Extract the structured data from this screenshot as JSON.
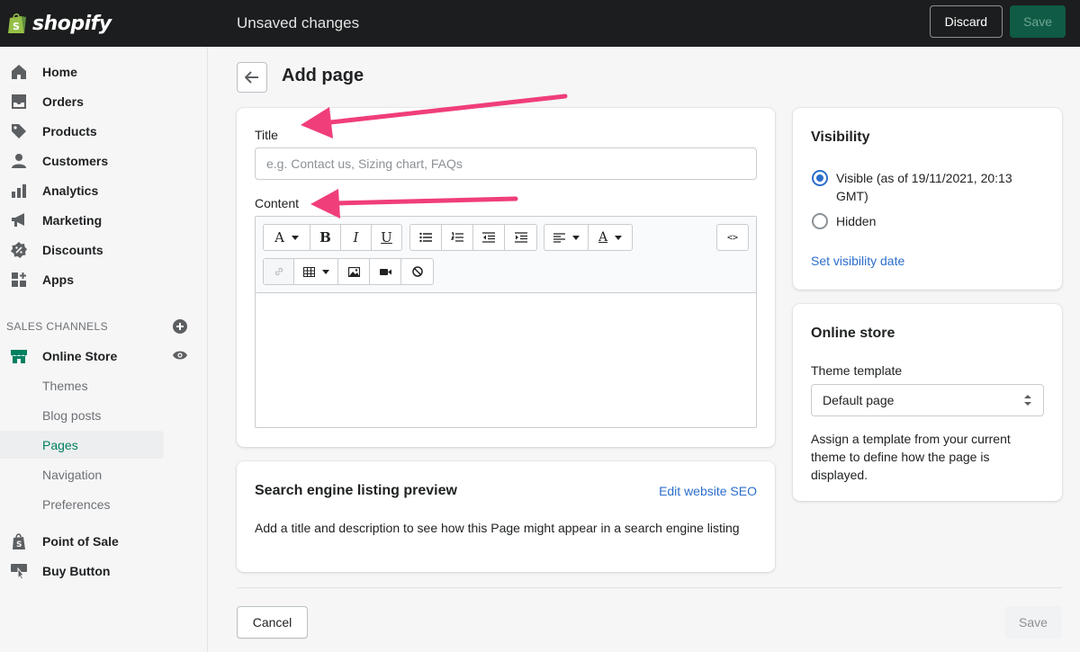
{
  "topbar": {
    "brand": "shopify",
    "status_text": "Unsaved changes",
    "discard_label": "Discard",
    "save_label": "Save"
  },
  "sidebar": {
    "items": [
      {
        "label": "Home",
        "icon": "home-icon"
      },
      {
        "label": "Orders",
        "icon": "orders-icon"
      },
      {
        "label": "Products",
        "icon": "tag-icon"
      },
      {
        "label": "Customers",
        "icon": "person-icon"
      },
      {
        "label": "Analytics",
        "icon": "bar-chart-icon"
      },
      {
        "label": "Marketing",
        "icon": "megaphone-icon"
      },
      {
        "label": "Discounts",
        "icon": "discount-icon"
      },
      {
        "label": "Apps",
        "icon": "apps-icon"
      }
    ],
    "sales_channels_label": "SALES CHANNELS",
    "online_store": {
      "label": "Online Store",
      "sub_items": [
        "Themes",
        "Blog posts",
        "Pages",
        "Navigation",
        "Preferences"
      ],
      "active": "Pages"
    },
    "point_of_sale": "Point of Sale",
    "buy_button": "Buy Button"
  },
  "main": {
    "page_title": "Add page",
    "title_label": "Title",
    "title_placeholder": "e.g. Contact us, Sizing chart, FAQs",
    "content_label": "Content",
    "seo": {
      "title": "Search engine listing preview",
      "link": "Edit website SEO",
      "description": "Add a title and description to see how this Page might appear in a search engine listing"
    },
    "cancel_label": "Cancel",
    "save_label": "Save"
  },
  "visibility": {
    "title": "Visibility",
    "visible_label": "Visible (as of 19/11/2021, 20:13 GMT)",
    "hidden_label": "Hidden",
    "selected": "visible",
    "link": "Set visibility date"
  },
  "online_store_card": {
    "title": "Online store",
    "template_label": "Theme template",
    "template_value": "Default page",
    "description": "Assign a template from your current theme to define how the page is displayed."
  },
  "colors": {
    "accent": "#008060",
    "link": "#2c6ecb",
    "annotation_arrow": "#f03e7a"
  }
}
